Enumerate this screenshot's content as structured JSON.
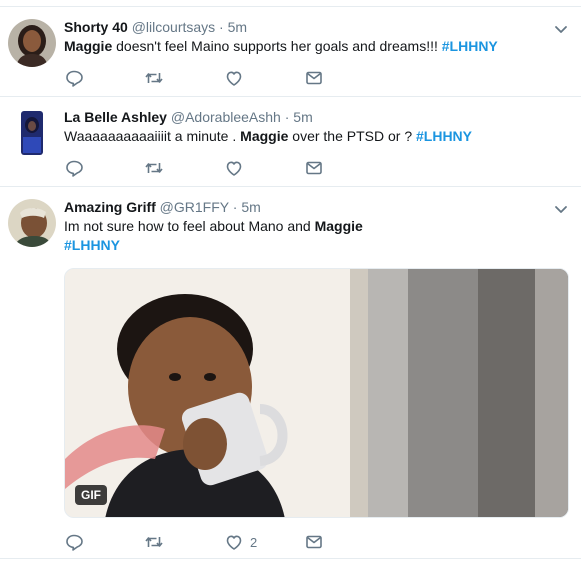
{
  "tweets": [
    {
      "fullname": "Shorty 40",
      "handle": "@lilcourtsays",
      "dot": "·",
      "time": "5m",
      "text": {
        "bold": "Maggie",
        "rest": " doesn't feel Maino supports her goals and dreams!!! ",
        "hashtag": "#LHHNY"
      }
    },
    {
      "fullname": "La Belle Ashley",
      "handle": "@AdorableeAshh",
      "dot": "·",
      "time": "5m",
      "text": {
        "pre": "Waaaaaaaaaaiiiit a minute . ",
        "bold": "Maggie",
        "rest": " over the PTSD or ?  ",
        "hashtag": "#LHHNY"
      }
    },
    {
      "fullname": "Amazing Griff",
      "handle": "@GR1FFY",
      "dot": "·",
      "time": "5m",
      "text": {
        "pre": "Im not sure how to feel about Mano and ",
        "bold": "Maggie",
        "hashtag": "#LHHNY"
      },
      "media": {
        "badge": "GIF"
      },
      "likes": "2"
    }
  ],
  "colors": {
    "accent": "#1b95e0",
    "muted": "#657786",
    "border": "#e6ecf0"
  },
  "icons": [
    "reply-icon",
    "retweet-icon",
    "like-icon",
    "direct-message-icon",
    "caret-down-icon"
  ]
}
